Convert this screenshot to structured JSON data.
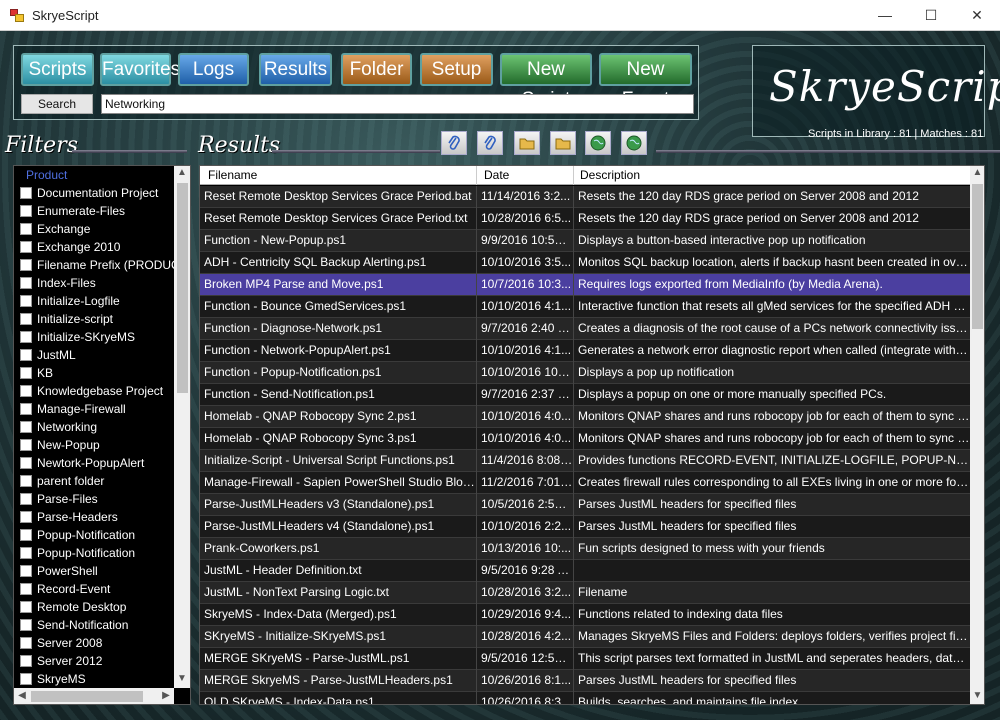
{
  "window": {
    "title": "SkryeScript"
  },
  "toolbar": {
    "buttons": [
      {
        "label": "Scripts"
      },
      {
        "label": "Favorites"
      },
      {
        "label": "Logs"
      },
      {
        "label": "Results"
      },
      {
        "label": "Folder"
      },
      {
        "label": "Setup"
      },
      {
        "label": "New Script"
      },
      {
        "label": "New Funct"
      }
    ],
    "search_label": "Search",
    "search_value": "Networking"
  },
  "logo": {
    "text": "SkryeScript"
  },
  "stats": {
    "text": "Scripts in Library : 81  |  Matches : 81"
  },
  "filters": {
    "header": "Filters",
    "column": "Product",
    "items": [
      "Documentation Project",
      "Enumerate-Files",
      "Exchange",
      "Exchange 2010",
      "Filename Prefix (PRODUCT -)",
      "Index-Files",
      "Initialize-Logfile",
      "Initialize-script",
      "Initialize-SKryeMS",
      "JustML",
      "KB",
      "Knowledgebase Project",
      "Manage-Firewall",
      "Networking",
      "New-Popup",
      "Newtork-PopupAlert",
      "parent folder",
      "Parse-Files",
      "Parse-Headers",
      "Popup-Notification",
      "Popup-Notification",
      "PowerShell",
      "Record-Event",
      "Remote Desktop",
      "Send-Notification",
      "Server 2008",
      "Server 2012",
      "SkryeMS"
    ]
  },
  "results": {
    "header": "Results",
    "columns": [
      "Filename",
      "Date",
      "Description"
    ],
    "rows": [
      [
        "Reset Remote Desktop Services Grace Period.bat",
        "11/14/2016 3:2...",
        "Resets the 120 day RDS grace period on Server 2008 and 2012"
      ],
      [
        "Reset Remote Desktop Services Grace Period.txt",
        "10/28/2016 6:5...",
        "Resets the 120 day RDS grace period on Server 2008 and 2012"
      ],
      [
        "Function - New-Popup.ps1",
        "9/9/2016 10:58 ...",
        "Displays a button-based interactive pop up notification"
      ],
      [
        "ADH - Centricity SQL Backup Alerting.ps1",
        "10/10/2016 3:5...",
        "Monitos SQL backup location, alerts if backup hasnt been created in over X days"
      ],
      [
        "Broken MP4 Parse and Move.ps1",
        "10/7/2016 10:3...",
        "Requires logs exported from MediaInfo (by Media Arena)."
      ],
      [
        "Function - Bounce GmedServices.ps1",
        "10/10/2016 4:1...",
        "Interactive function that resets all gMed services for the specified ADH site on D..."
      ],
      [
        "Function - Diagnose-Network.ps1",
        "9/7/2016 2:40 PM",
        "Creates a diagnosis of the root cause of a PCs network connectivity issues"
      ],
      [
        "Function - Network-PopupAlert.ps1",
        "10/10/2016 4:1...",
        "Generates a network error diagnostic report when called (integrate with newtork ..."
      ],
      [
        "Function - Popup-Notification.ps1",
        "10/10/2016 10:57 ...",
        "Displays a pop up notification"
      ],
      [
        "Function - Send-Notification.ps1",
        "9/7/2016 2:37 PM",
        "Displays a popup on one or more manually specified PCs."
      ],
      [
        "Homelab - QNAP Robocopy Sync 2.ps1",
        "10/10/2016 4:0...",
        "Monitors QNAP shares and runs robocopy job for each of them to sync files to b..."
      ],
      [
        "Homelab - QNAP Robocopy Sync 3.ps1",
        "10/10/2016 4:0...",
        "Monitors QNAP shares and runs robocopy job for each of them to sync files to b..."
      ],
      [
        "Initialize-Script - Universal Script Functions.ps1",
        "11/4/2016 8:08 ...",
        "Provides functions RECORD-EVENT, INITIALIZE-LOGFILE, POPUP-NOTIFICA..."
      ],
      [
        "Manage-Firewall - Sapien PowerShell Studio Blocker.ps1",
        "11/2/2016 7:01 ...",
        "Creates firewall rules corresponding to all EXEs living in one or more folders"
      ],
      [
        "Parse-JustMLHeaders v3 (Standalone).ps1",
        "10/5/2016 2:59 ...",
        "Parses JustML headers for specified files"
      ],
      [
        "Parse-JustMLHeaders v4 (Standalone).ps1",
        "10/10/2016 2:2...",
        "Parses JustML headers for specified files"
      ],
      [
        "Prank-Coworkers.ps1",
        "10/13/2016 10:...",
        "Fun scripts designed to mess with your friends"
      ],
      [
        "JustML - Header Definition.txt",
        "9/5/2016 9:28 AM",
        ""
      ],
      [
        "JustML - NonText Parsing Logic.txt",
        "10/28/2016 3:2...",
        "Filename"
      ],
      [
        "SkryeMS - Index-Data (Merged).ps1",
        "10/29/2016 9:4...",
        "Functions related to indexing data files"
      ],
      [
        "SKryeMS - Initialize-SKryeMS.ps1",
        "10/28/2016 4:2...",
        "Manages SkryeMS Files and Folders: deploys folders, verifies project files, create..."
      ],
      [
        "MERGE SKryeMS - Parse-JustML.ps1",
        "9/5/2016 12:59 ...",
        "This script parses text formatted in JustML and seperates headers, data, and the..."
      ],
      [
        "MERGE SkryeMS - Parse-JustMLHeaders.ps1",
        "10/26/2016 8:1...",
        "Parses JustML headers for specified files"
      ],
      [
        "OLD SKryeMS - Index-Data.ps1",
        "10/26/2016 8:3...",
        "Builds, searches, and maintains file index"
      ]
    ],
    "selected_row": 4
  },
  "colors": {
    "selected_row": "#4b3fa0",
    "grid_bg": "#000000",
    "filter_header": "#4f6fe0"
  }
}
